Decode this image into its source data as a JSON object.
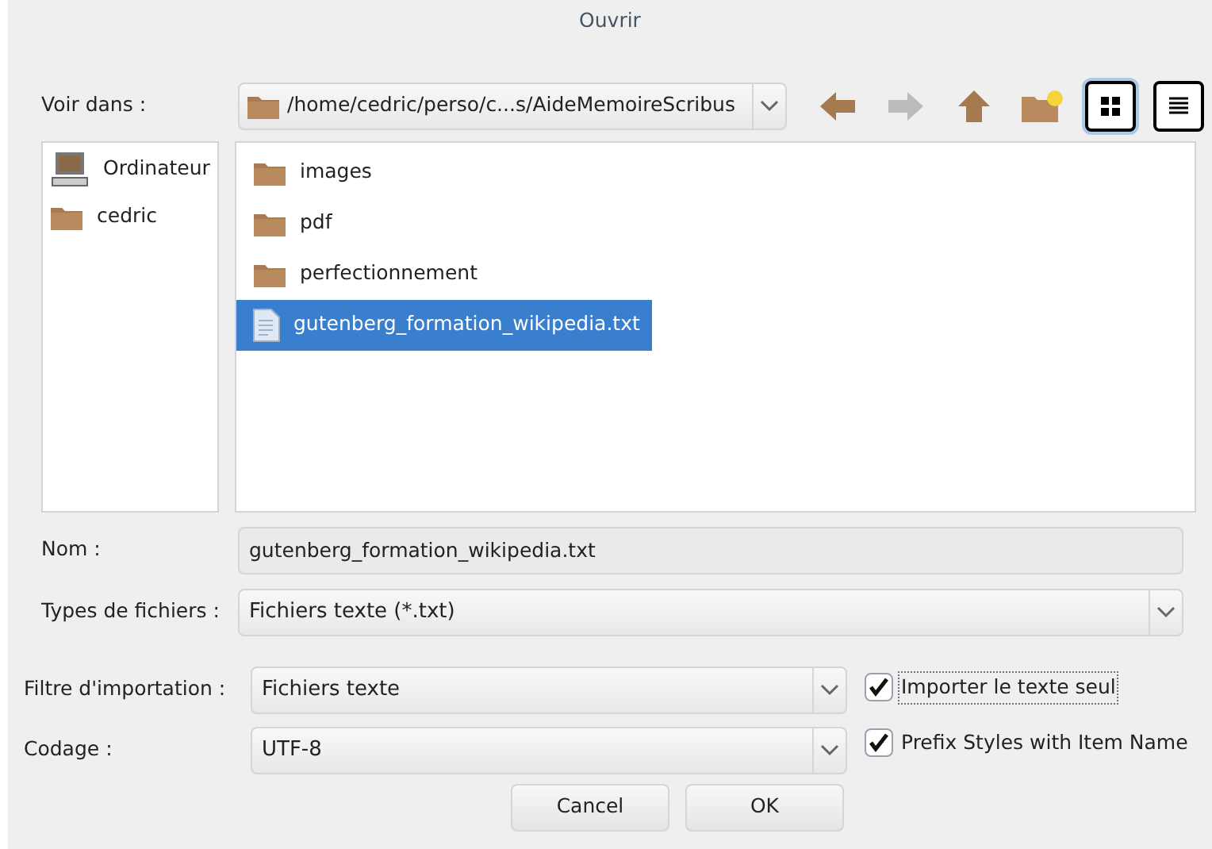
{
  "window": {
    "title": "Ouvrir"
  },
  "location": {
    "label": "Voir dans :",
    "path": "/home/cedric/perso/c...s/AideMemoireScribus"
  },
  "toolbar": [
    {
      "kind": "back",
      "disabled": false
    },
    {
      "kind": "forward",
      "disabled": true
    },
    {
      "kind": "up",
      "disabled": false
    },
    {
      "kind": "newfolder",
      "disabled": false
    },
    {
      "kind": "icons",
      "selected": true
    },
    {
      "kind": "list",
      "selected": false
    }
  ],
  "sidebar": {
    "items": [
      {
        "kind": "computer",
        "label": "Ordinateur"
      },
      {
        "kind": "folder",
        "label": "cedric"
      }
    ]
  },
  "files": [
    {
      "kind": "folder",
      "name": "images",
      "selected": false
    },
    {
      "kind": "folder",
      "name": "pdf",
      "selected": false
    },
    {
      "kind": "folder",
      "name": "perfectionnement",
      "selected": false
    },
    {
      "kind": "text",
      "name": "gutenberg_formation_wikipedia.txt",
      "selected": true
    }
  ],
  "name_field": {
    "label": "Nom :",
    "value": "gutenberg_formation_wikipedia.txt"
  },
  "file_types": {
    "label": "Types de fichiers :",
    "value": "Fichiers texte (*.txt)"
  },
  "import_filter": {
    "label": "Filtre d'importation :",
    "value": "Fichiers texte"
  },
  "encoding": {
    "label": "Codage :",
    "value": "UTF-8"
  },
  "options": [
    {
      "label": "Importer le texte seul",
      "checked": true,
      "focused": true
    },
    {
      "label": "Prefix Styles with Item Name",
      "checked": true,
      "focused": false
    }
  ],
  "buttons": [
    "Cancel",
    "OK"
  ]
}
